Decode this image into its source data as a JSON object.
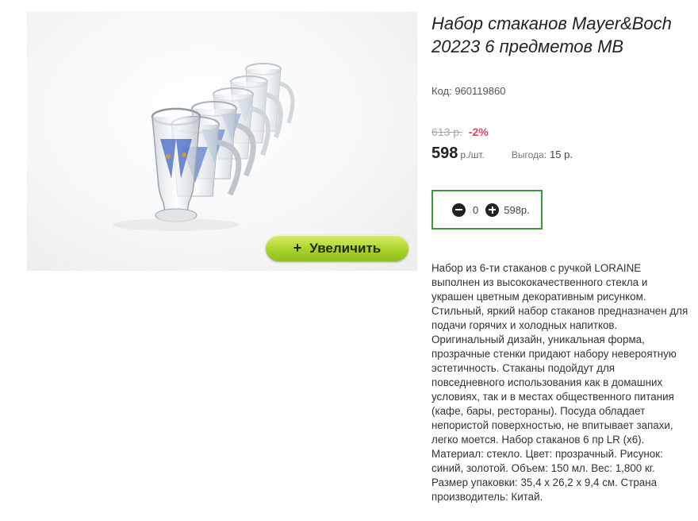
{
  "product": {
    "title": "Набор стаканов Mayer&Boch 20223 6 предметов MB",
    "code": "Код: 960119860",
    "old_price": "613 р.",
    "discount": "-2%",
    "price": "598",
    "unit": "р./шт.",
    "benefit_label": "Выгода:",
    "benefit_value": "15 р.",
    "description": "Набор из 6-ти стаканов с ручкой LORAINE выполнен из высококачественного стекла и украшен цветным декоративным рисунком. Стильный, яркий набор стаканов предназначен для подачи горячих и холодных напитков. Оригинальный дизайн, уникальная форма, прозрачные стенки придают набору невероятную эстетичность. Стаканы подойдут для повседневного использования как в домашних условиях, так и в местах общественного питания (кафе, бары, рестораны). Посуда обладает непористой поверхностью, не впитывает запахи, легко моется. Набор стаканов 6 пр LR (x6). Материал: стекло. Цвет: прозрачный. Рисунок: синий, золотой. Объем: 150 мл. Вес: 1,800 кг. Размер упаковки: 35,4 x 26,2 x 9,4 см. Страна производитель: Китай."
  },
  "gallery": {
    "zoom_icon": "+",
    "zoom_label": "Увеличить"
  },
  "cart": {
    "quantity": "0",
    "total": "598р.",
    "minus_icon": "minus-circle-icon",
    "plus_icon": "plus-circle-icon"
  },
  "colors": {
    "accent_green": "#3a9a3a",
    "zoom_button": "#a9d22b",
    "discount_red": "#d9465a"
  }
}
